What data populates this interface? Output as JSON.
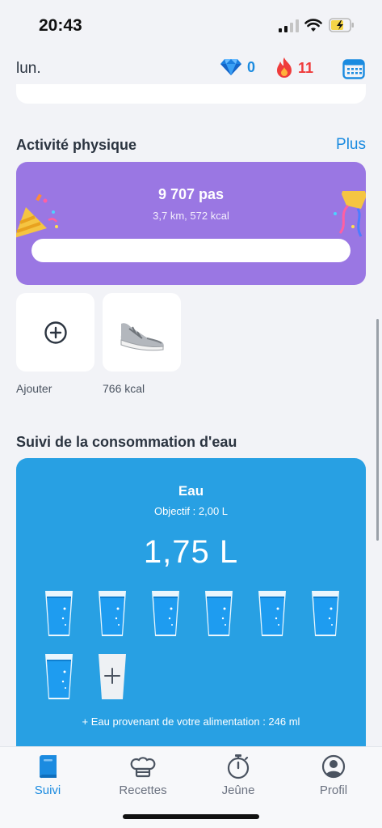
{
  "status_bar": {
    "time": "20:43"
  },
  "header": {
    "day": "lun.",
    "gems": "0",
    "streak": "11"
  },
  "activity": {
    "title": "Activité physique",
    "more_label": "Plus",
    "steps": "9 707 pas",
    "details": "3,7 km, 572 kcal",
    "add_label": "Ajouter",
    "activity_kcal": "766 kcal"
  },
  "water": {
    "section_title": "Suivi de la consommation d'eau",
    "title": "Eau",
    "goal": "Objectif : 2,00 L",
    "amount": "1,75 L",
    "filled_glasses": 7,
    "food_note": "+ Eau provenant de votre alimentation : 246 ml"
  },
  "nav": {
    "items": [
      {
        "label": "Suivi",
        "icon": "book-icon",
        "active": true
      },
      {
        "label": "Recettes",
        "icon": "chef-hat-icon",
        "active": false
      },
      {
        "label": "Jeûne",
        "icon": "stopwatch-icon",
        "active": false
      },
      {
        "label": "Profil",
        "icon": "profile-icon",
        "active": false
      }
    ]
  },
  "colors": {
    "accent": "#1b8be0",
    "activity_card": "#9a77e3",
    "water_card": "#28a0e3",
    "streak": "#ef3b3b"
  }
}
